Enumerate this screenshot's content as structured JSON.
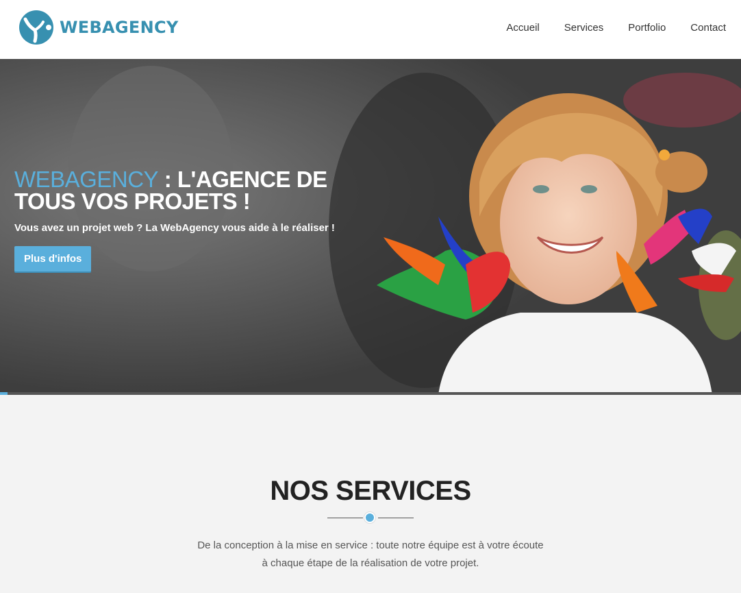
{
  "header": {
    "logo_text": "WEBAGENCY",
    "nav": [
      {
        "label": "Accueil"
      },
      {
        "label": "Services"
      },
      {
        "label": "Portfolio"
      },
      {
        "label": "Contact"
      }
    ]
  },
  "hero": {
    "title_brand": "WEBAGENCY",
    "title_rest": " : L'AGENCE DE TOUS VOS PROJETS !",
    "subtitle": "Vous avez un projet web ? La WebAgency vous aide à le réaliser !",
    "button_label": "Plus d'infos",
    "slider_progress": 0.01
  },
  "services": {
    "title": "NOS SERVICES",
    "description_line1": "De la conception à la mise en service : toute notre équipe est à votre écoute",
    "description_line2": "à chaque étape de la réalisation de votre projet."
  },
  "colors": {
    "accent": "#5aafdc",
    "brand": "#3790b0",
    "heading": "#222222",
    "section_bg": "#f3f3f3"
  }
}
